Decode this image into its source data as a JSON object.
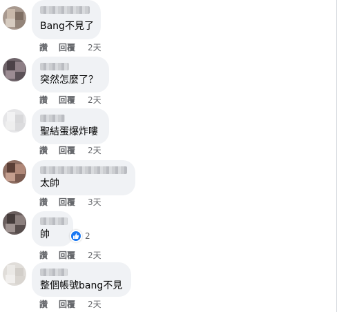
{
  "comments": [
    {
      "text": "Bang不見了",
      "like": "讚",
      "reply": "回覆",
      "time": "2天"
    },
    {
      "text": "突然怎麼了？",
      "like": "讚",
      "reply": "回覆",
      "time": "2天"
    },
    {
      "text": "聖結蛋爆炸嘍",
      "like": "讚",
      "reply": "回覆",
      "time": "2天"
    },
    {
      "text": "太帥",
      "like": "讚",
      "reply": "回覆",
      "time": "3天"
    },
    {
      "text": "帥",
      "like": "讚",
      "reply": "回覆",
      "time": "2天",
      "reaction_icon": "like-icon",
      "reaction_count": "2"
    },
    {
      "text": "整個帳號bang不見",
      "like": "讚",
      "reply": "回覆",
      "time": "2天"
    }
  ],
  "colors": {
    "bubble": "#f0f2f5",
    "text": "#050505",
    "meta": "#65676b",
    "like_blue": "#1877f2"
  }
}
